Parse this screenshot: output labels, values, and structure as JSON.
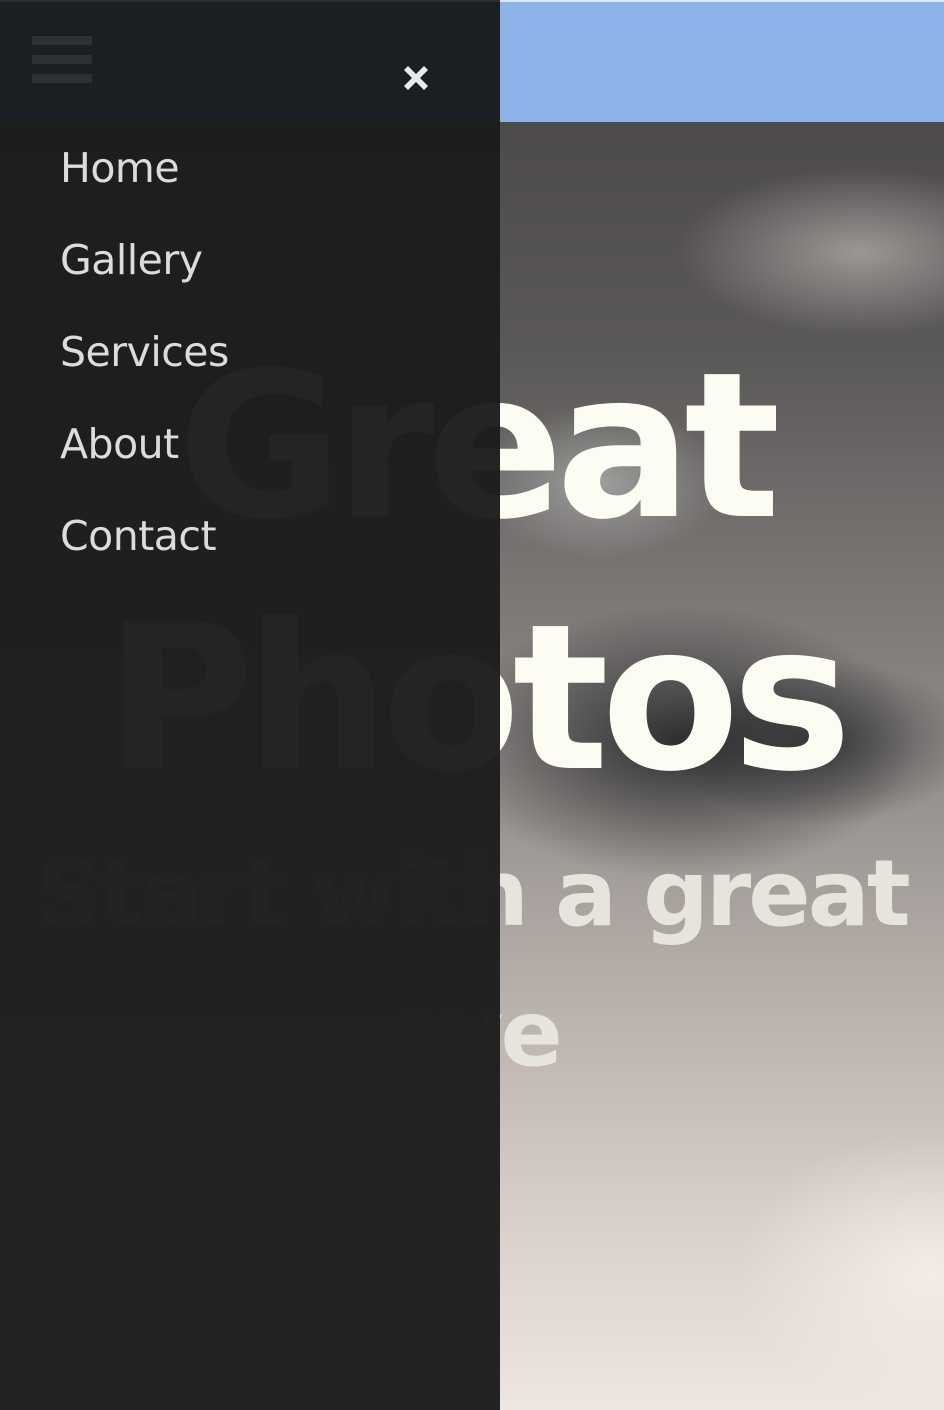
{
  "header": {
    "menu_icon": "hamburger-icon",
    "close_icon": "close-x-icon"
  },
  "nav": {
    "items": [
      {
        "label": "Home"
      },
      {
        "label": "Gallery"
      },
      {
        "label": "Services"
      },
      {
        "label": "About"
      },
      {
        "label": "Contact"
      }
    ]
  },
  "hero": {
    "title_line1": "Great",
    "title_line2": "Photos",
    "subtitle": "Start with a great eye"
  },
  "colors": {
    "header_bar": "#8db2e8",
    "menu_header": "#1b1e23",
    "menu_panel": "#1c1c1c",
    "hero_title": "#fcfcf2"
  }
}
